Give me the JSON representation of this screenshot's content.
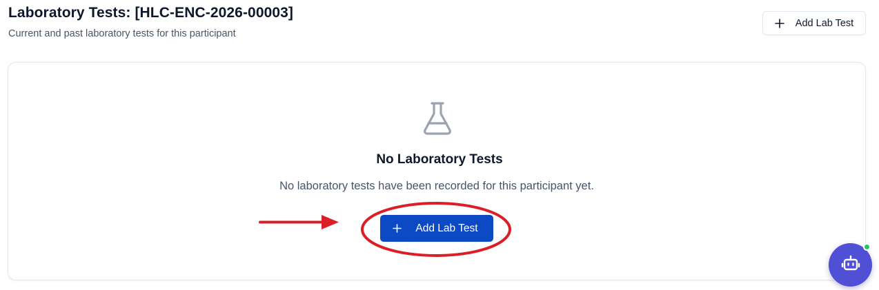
{
  "header": {
    "title": "Laboratory Tests: [HLC-ENC-2026-00003]",
    "subtitle": "Current and past laboratory tests for this participant",
    "add_button_label": "Add Lab Test"
  },
  "empty_state": {
    "icon": "flask-icon",
    "title": "No Laboratory Tests",
    "message": "No laboratory tests have been recorded for this participant yet.",
    "button_label": "Add Lab Test"
  },
  "assistant": {
    "icon": "robot-icon",
    "status": "online"
  },
  "colors": {
    "primary": "#0b49c5",
    "annotation_red": "#dc1f26",
    "assistant_bg": "#5050d6",
    "status_green": "#22c55e",
    "muted_icon": "#9ca3af"
  }
}
